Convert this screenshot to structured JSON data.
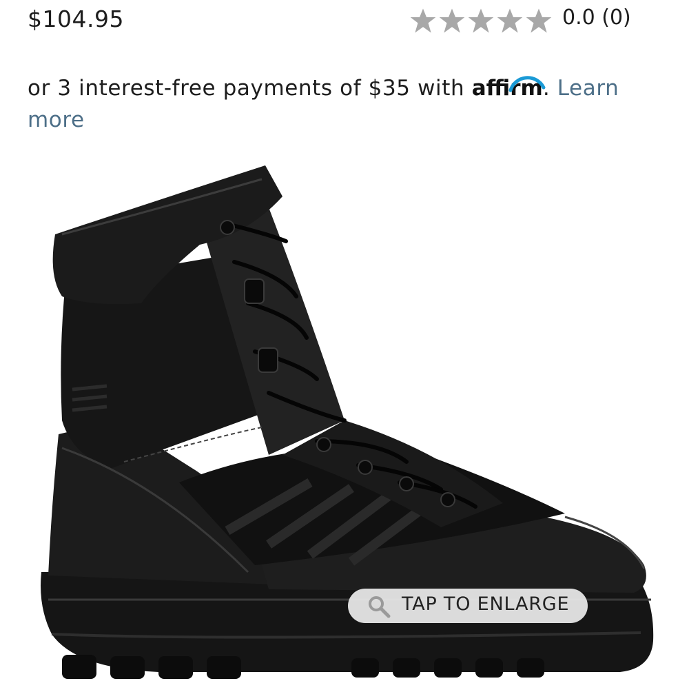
{
  "product": {
    "price": "$104.95",
    "rating": {
      "value": 0.0,
      "text": "0.0 (0)",
      "stars_total": 5,
      "star_color": "#a8a8a8"
    }
  },
  "financing": {
    "prefix": "or 3 interest-free payments of $35 with ",
    "provider": "affirm",
    "suffix": ". ",
    "learn_more": "Learn more",
    "link_color": "#4d6f88",
    "affirm_arc_color": "#1a9ad6"
  },
  "image": {
    "alt": "black tactical boot",
    "enlarge_label": "TAP TO ENLARGE",
    "enlarge_icon": "magnifier-icon"
  }
}
